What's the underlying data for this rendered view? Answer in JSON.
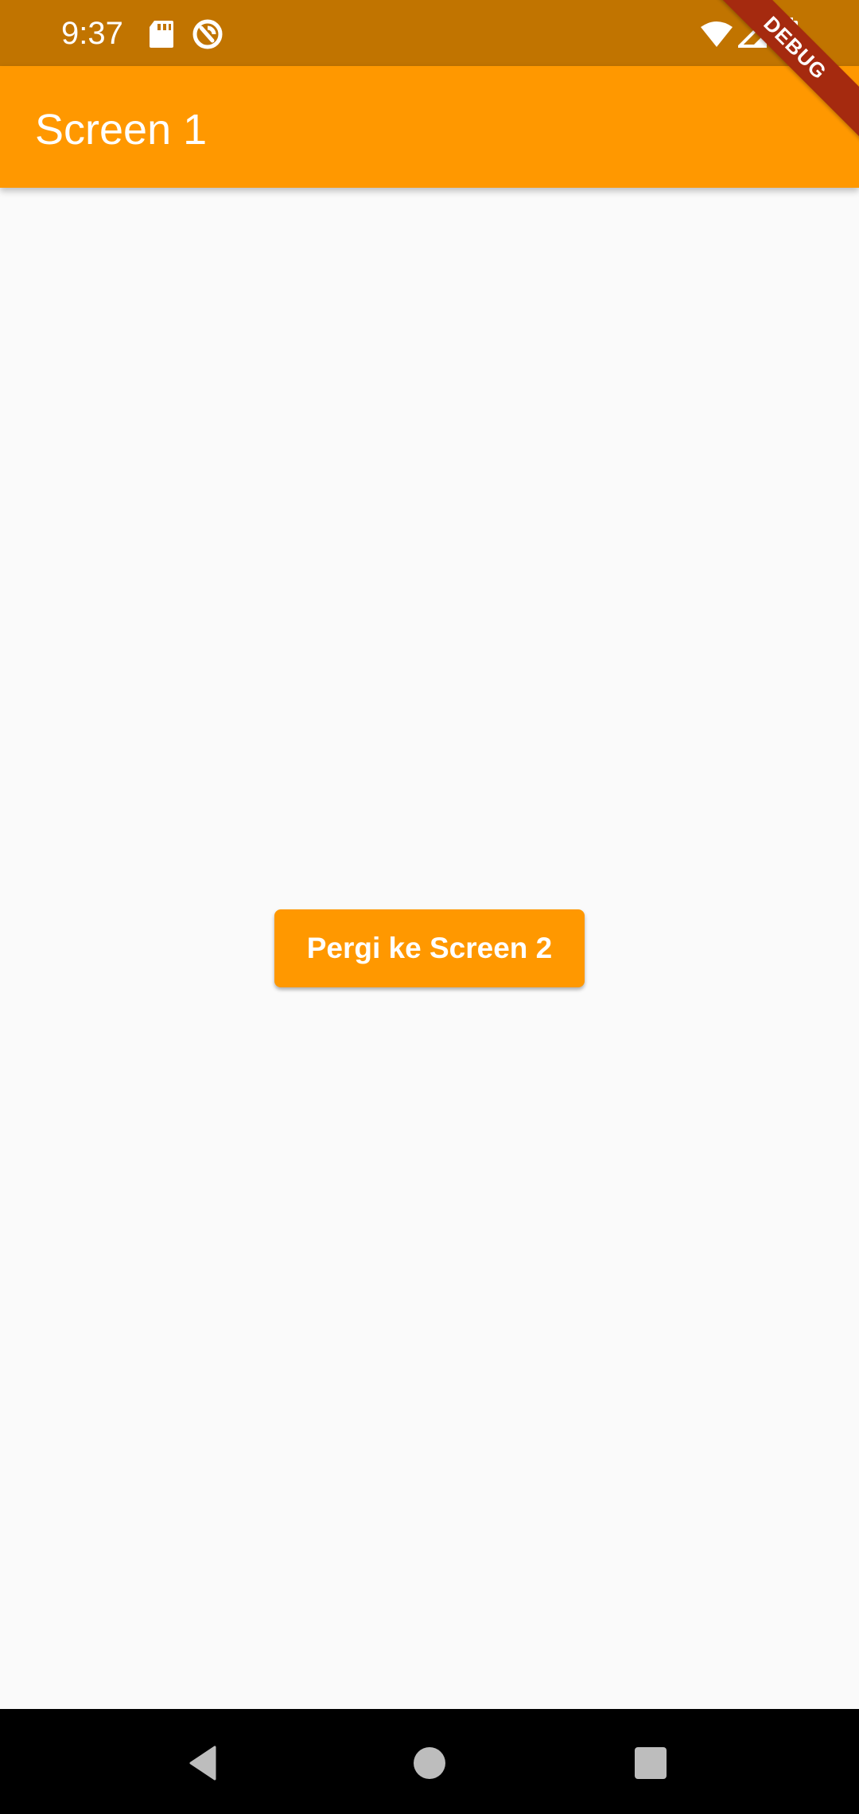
{
  "status_bar": {
    "time": "9:37",
    "icons": [
      "sd-card-icon",
      "data-saver-icon",
      "wifi-icon",
      "signal-icon",
      "battery-icon"
    ]
  },
  "debug_banner": {
    "label": "DEBUG"
  },
  "app_bar": {
    "title": "Screen 1"
  },
  "main": {
    "button_label": "Pergi ke Screen 2"
  },
  "nav_bar": {
    "icons": [
      "back-icon",
      "home-icon",
      "recents-icon"
    ]
  },
  "colors": {
    "status_bar": "#c17400",
    "app_bar": "#ff9800",
    "button": "#ff9800",
    "background": "#fafafa",
    "debug_banner": "#a52a0f"
  }
}
